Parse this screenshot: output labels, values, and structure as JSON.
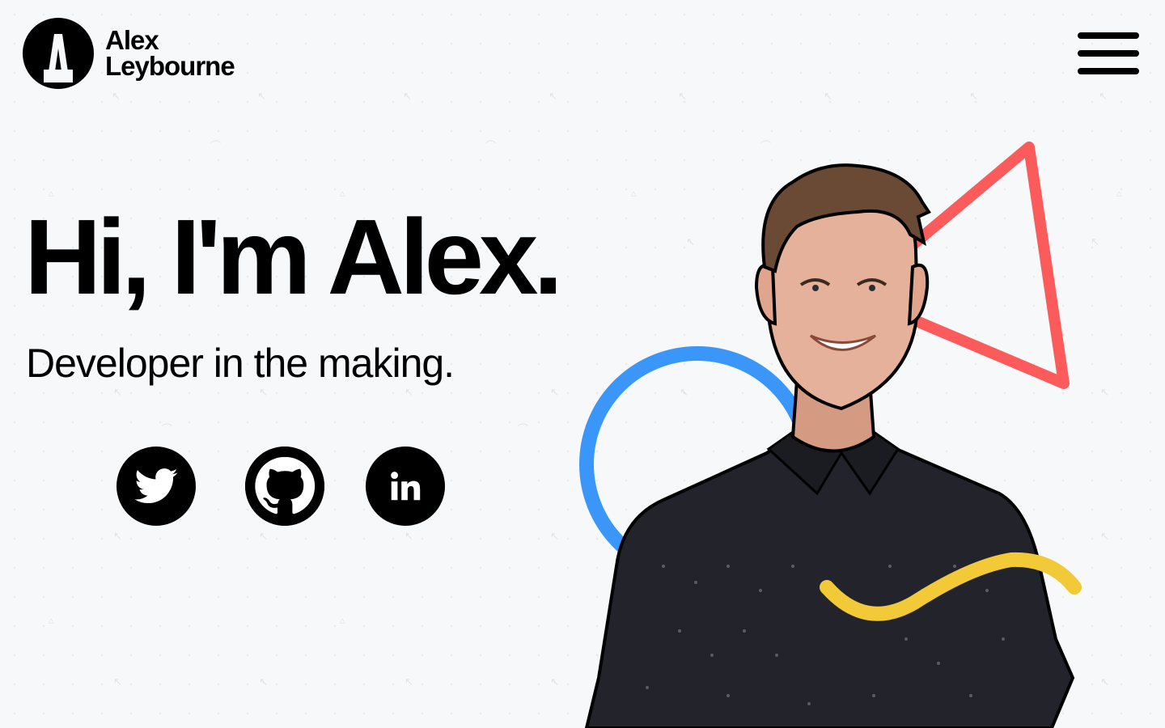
{
  "header": {
    "logo_line1": "Alex",
    "logo_line2": "Leybourne",
    "logo_icon": "letter-a-logo",
    "menu_icon": "hamburger-menu-icon"
  },
  "hero": {
    "title": "Hi, I'm Alex.",
    "subtitle": "Developer in the making."
  },
  "social": [
    {
      "name": "twitter",
      "icon": "twitter-icon"
    },
    {
      "name": "github",
      "icon": "github-icon"
    },
    {
      "name": "linkedin",
      "icon": "linkedin-icon",
      "label": "in"
    }
  ],
  "colors": {
    "background": "#f6f8fa",
    "text": "#000000",
    "triangle": "#fb5b5b",
    "circle": "#3a97f9",
    "wave": "#f2c937",
    "shirt": "#23242b",
    "skin": "#e6b19a",
    "hair": "#6b4a35"
  }
}
